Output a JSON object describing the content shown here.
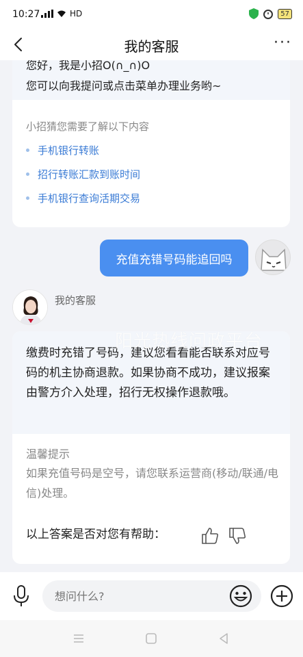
{
  "status": {
    "time": "10:27",
    "network": "HD",
    "battery": "57"
  },
  "header": {
    "title": "我的客服",
    "more": "···"
  },
  "greeting": {
    "line1": "您好，我是小招O(∩_∩)O",
    "line2": "您可以向我提问或点击菜单办理业务哟~"
  },
  "guess": {
    "title": "小招猜您需要了解以下内容",
    "items": [
      "手机银行转账",
      "招行转账汇款到账时间",
      "手机银行查询活期交易"
    ]
  },
  "user_message": "充值充错号码能追回吗",
  "agent": {
    "name": "我的客服",
    "answer": "缴费时充错了号码，建议您看看能否联系对应号码的机主协商退款。如果协商不成功，建议报案由警方介入处理，招行无权操作退款哦。",
    "watermark": "阳光热线问政平台",
    "tip_title": "温馨提示",
    "tip_text": "如果充值号码是空号，请您联系运营商(移动/联通/电信)处理。",
    "helpful_question": "以上答案是否对您有帮助："
  },
  "input": {
    "placeholder": "想问什么?"
  },
  "colors": {
    "accent": "#4a8ff0",
    "link": "#3a7bd5",
    "background": "#f2f3f7"
  }
}
